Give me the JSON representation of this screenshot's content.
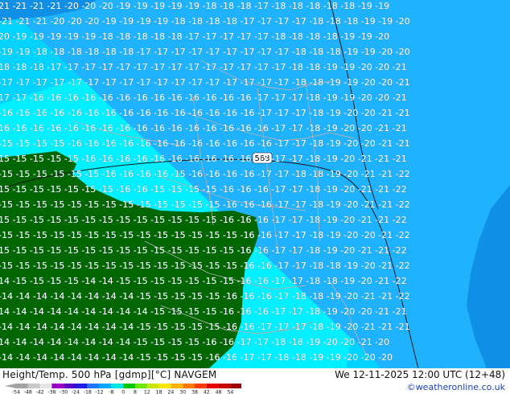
{
  "title": {
    "left": "Height/Temp. 500 hPa [gdmp][°C] NAVGEM",
    "right": "We 12-11-2025 12:00 UTC (12+48)"
  },
  "credit": "©weatheronline.co.uk",
  "contour_label": "568",
  "scale": {
    "labels": [
      "-54",
      "-48",
      "-42",
      "-38",
      "-30",
      "-24",
      "-18",
      "-12",
      "-8",
      "0",
      "8",
      "12",
      "18",
      "24",
      "30",
      "38",
      "42",
      "48",
      "54"
    ],
    "colors": [
      "#a3a3a3",
      "#c8c8c8",
      "#e6e6e6",
      "#9a00c8",
      "#5a00c8",
      "#1e1ee6",
      "#1e78ff",
      "#00aaff",
      "#00e6e6",
      "#00c800",
      "#6ee600",
      "#c8e600",
      "#ffe600",
      "#ffb400",
      "#ff7800",
      "#ff3c00",
      "#e60000",
      "#c80000",
      "#a00000"
    ]
  },
  "colors": {
    "cold_deep": "#0f8fe6",
    "cold_mid": "#1fb2ff",
    "cold_light": "#00d3ff",
    "mild": "#00f0ff",
    "land_green": "#006600",
    "contour": "#1a1a1a",
    "border": "#b0b0b0"
  },
  "map": {
    "label_rows": [
      "-21 -21 -21 -21 -20 -20 -20 -19 -19 -19 -19 -19 -18 -18 -18 -17 -18 -18 -18 -18 -18 -19 -19",
      "-21 -21 -21 -20 -20 -20 -19 -19 -19 -19 -18 -18 -18 -18 -17 -17 -17 -17 -18 -18 -18 -19 -19 -20",
      "-20 -19 -19 -19 -19 -19 -18 -18 -18 -18 -18 -17 -17 -17 -17 -17 -18 -18 -18 -18 -19 -19 -20",
      "-19 -19 -18 -18 -18 -18 -18 -18 -17 -17 -17 -17 -17 -17 -17 -17 -17 -18 -18 -18 -19 -19 -20 -20",
      "-18 -18 -18 -17 -17 -17 -17 -17 -17 -17 -17 -17 -17 -17 -17 -17 -17 -18 -18 -19 -19 -20 -20 -21",
      "-17 -17 -17 -17 -17 -17 -17 -17 -17 -17 -17 -17 -17 -17 -17 -17 -17 -18 -18 -19 -19 -20 -20 -21",
      "-17 -17 -16 -16 -16 -16 -16 -16 -16 -16 -16 -16 -16 -16 -16 -17 -17 -17 -18 -19 -19 -20 -20 -21",
      "-16 -16 -16 -16 -16 -16 -16 -16 -16 -16 -16 -16 -16 -16 -16 -17 -17 -17 -18 -19 -20 -20 -21 -21",
      "-16 -16 -16 -16 -16 -16 -16 -16 -16 -16 -16 -16 -16 -16 -16 -16 -17 -17 -18 -19 -20 -20 -21 -21",
      "-15 -15 -15 -15 -16 -16 -16 -16 -16 -16 -16 -16 -16 -16 -16 -16 -17 -17 -18 -19 -20 -20 -21 -21",
      "-15 -15 -15 -15 -15 -16 -16 -16 -16 -16 -16 -16 -16 -16 -16 -17 -17 -17 -18 -19 -20 -21 -21 -21",
      "-15 -15 -15 -15 -15 -15 -16 -16 -16 -16 -15 -16 -16 -16 -16 -17 -17 -18 -18 -19 -20 -21 -21 -22",
      "-15 -15 -15 -15 -15 -15 -15 -16 -16 -15 -15 -15 -15 -16 -16 -16 -17 -17 -18 -19 -20 -21 -21 -22",
      "-15 -15 -15 -15 -15 -15 -15 -15 -15 -15 -15 -15 -15 -16 -16 -16 -17 -17 -18 -19 -20 -21 -21 -22",
      "-15 -15 -15 -15 -15 -15 -15 -15 -15 -15 -15 -15 -15 -16 -16 -16 -17 -17 -18 -19 -20 -21 -21 -22",
      "-15 -15 -15 -15 -15 -15 -15 -15 -15 -15 -15 -15 -15 -15 -16 -16 -17 -17 -18 -19 -20 -20 -21 -22",
      "-15 -15 -15 -15 -15 -15 -15 -15 -15 -15 -15 -15 -15 -15 -16 -16 -17 -17 -18 -19 -20 -21 -21 -22",
      "-15 -15 -15 -15 -15 -15 -15 -15 -15 -15 -15 -15 -15 -15 -16 -16 -17 -17 -18 -18 -19 -20 -21 -22",
      "-14 -15 -15 -15 -15 -14 -14 -15 -15 -15 -15 -15 -15 -15 -16 -16 -17 -17 -18 -18 -19 -20 -21 -22",
      "-14 -14 -14 -14 -14 -14 -14 -14 -15 -15 -15 -15 -15 -16 -16 -16 -17 -18 -18 -19 -20 -21 -21 -22",
      "-14 -14 -14 -14 -14 -14 -14 -14 -14 -15 -15 -15 -15 -16 -16 -16 -17 -17 -18 -19 -20 -20 -21 -21",
      "-14 -14 -14 -14 -14 -14 -14 -14 -15 -15 -15 -15 -15 -16 -16 -17 -17 -17 -18 -19 -20 -21 -21 -21",
      "-14 -14 -14 -14 -14 -14 -14 -14 -15 -15 -15 -15 -16 -16 -17 -17 -18 -18 -19 -20 -20 -21 -20",
      "-14 -14 -14 -14 -14 -14 -14 -14 -15 -15 -15 -15 -16 -16 -17 -17 -18 -18 -19 -19 -20 -20 -20"
    ]
  }
}
